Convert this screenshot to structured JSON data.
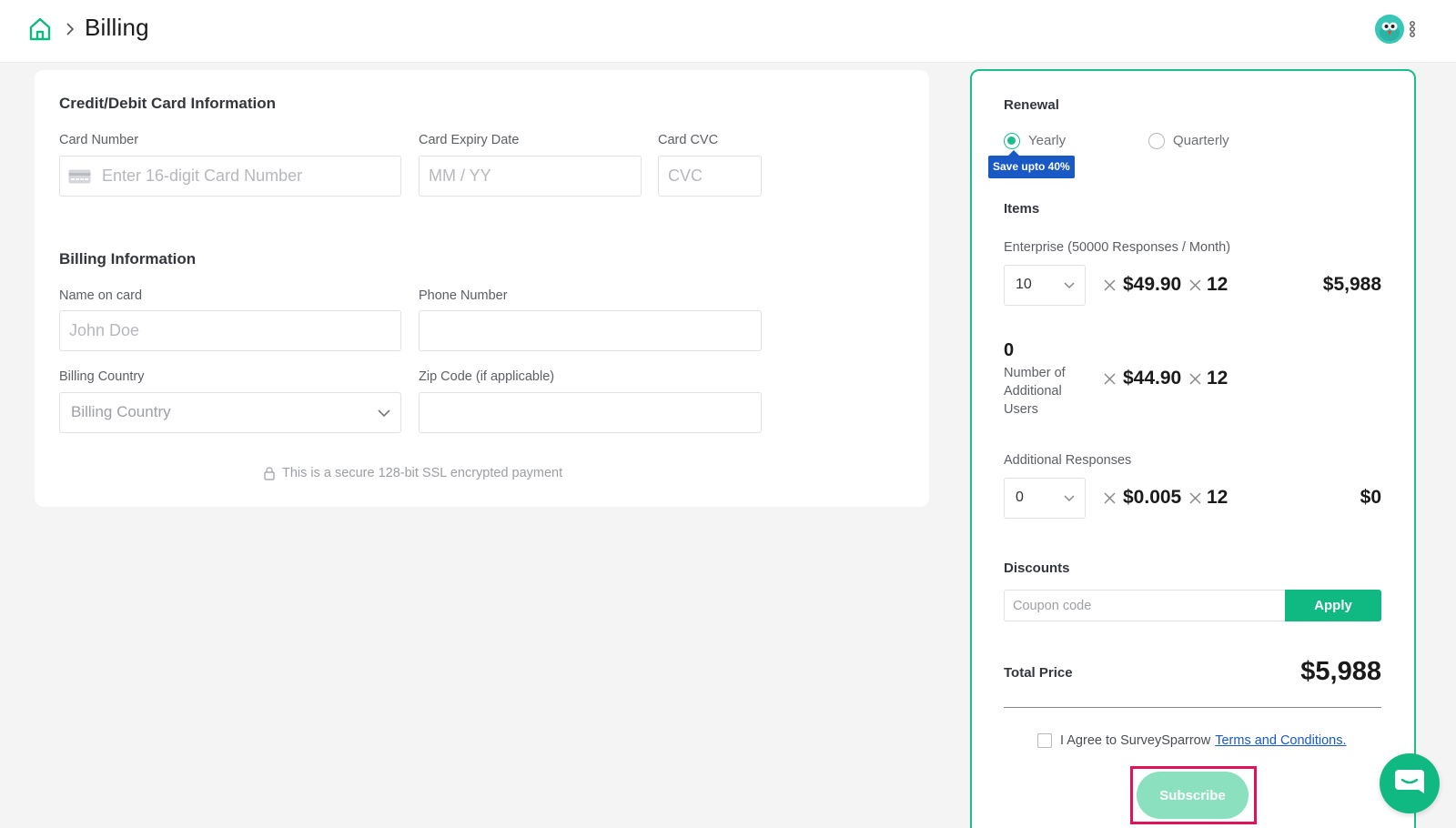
{
  "header": {
    "title": "Billing",
    "home_icon": "home-icon",
    "separator_icon": "chevron-right-icon",
    "menu_icon": "kebab-menu-icon",
    "brand_color": "#10b981"
  },
  "card_info": {
    "title": "Credit/Debit Card Information",
    "card_number_label": "Card Number",
    "card_number_placeholder": "Enter 16-digit Card Number",
    "expiry_label": "Card Expiry Date",
    "expiry_placeholder": "MM / YY",
    "cvc_label": "Card CVC",
    "cvc_placeholder": "CVC"
  },
  "billing_info": {
    "title": "Billing Information",
    "name_label": "Name on card",
    "name_placeholder": "John Doe",
    "phone_label": "Phone Number",
    "phone_value": "",
    "country_label": "Billing Country",
    "country_placeholder": "Billing Country",
    "zip_label": "Zip Code (if applicable)",
    "zip_value": ""
  },
  "secure_note": "This is a secure 128-bit SSL encrypted payment",
  "order": {
    "renewal_title": "Renewal",
    "renewal_options": [
      {
        "label": "Yearly",
        "selected": true
      },
      {
        "label": "Quarterly",
        "selected": false
      }
    ],
    "save_badge": "Save upto 40%",
    "items_title": "Items",
    "plan_label": "Enterprise (50000 Responses / Month)",
    "plan_qty": "10",
    "plan_price": "$49.90",
    "plan_months": "12",
    "plan_total": "$5,988",
    "users_count": "0",
    "users_label": "Number of Additional Users",
    "users_price": "$44.90",
    "users_months": "12",
    "responses_label": "Additional Responses",
    "responses_qty": "0",
    "responses_price": "$0.005",
    "responses_months": "12",
    "responses_total": "$0",
    "discounts_title": "Discounts",
    "coupon_placeholder": "Coupon code",
    "apply_label": "Apply",
    "total_label": "Total Price",
    "total_value": "$5,988",
    "agree_text": "I Agree to SurveySparrow",
    "terms_link": "Terms and Conditions.",
    "subscribe_label": "Subscribe"
  },
  "colors": {
    "accent": "#10b981",
    "badge": "#1859c6",
    "highlight": "#e0125a",
    "subscribe_disabled": "#8be0c0"
  }
}
